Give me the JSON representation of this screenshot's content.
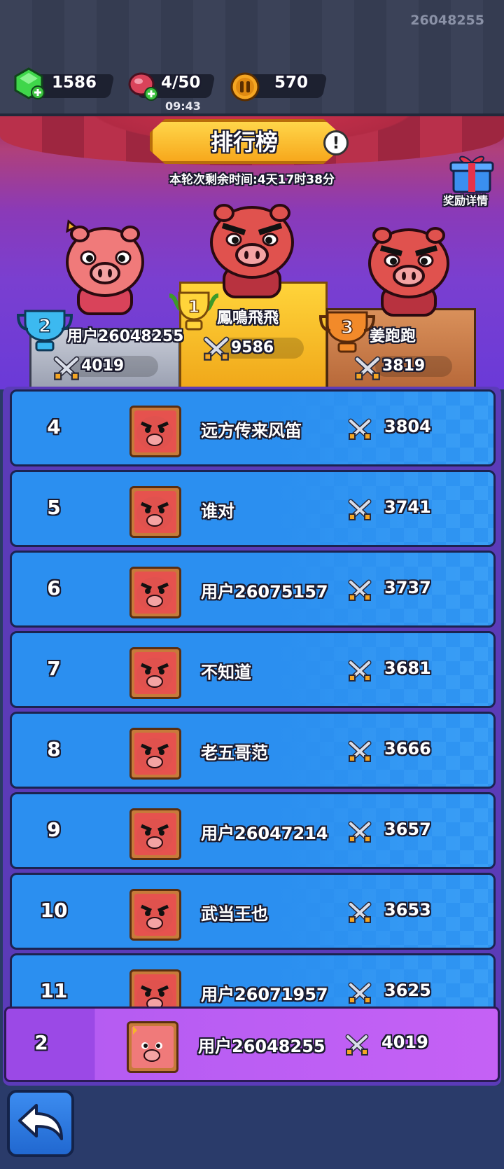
{
  "header": {
    "user_id": "26048255",
    "gems": "1586",
    "energy": "4/50",
    "energy_timer": "09:43",
    "coins": "570"
  },
  "leaderboard": {
    "title": "排行榜",
    "info_icon": "!",
    "remaining_time": "本轮次剩余时间:4天17时38分",
    "reward_label": "奖励详情"
  },
  "podium": [
    {
      "rank": "1",
      "name": "鳳鳴飛飛",
      "score": "9586"
    },
    {
      "rank": "2",
      "name": "用户26048255",
      "score": "4019"
    },
    {
      "rank": "3",
      "name": "姜跑跑",
      "score": "3819"
    }
  ],
  "rows": [
    {
      "rank": "4",
      "name": "远方传来风笛",
      "score": "3804"
    },
    {
      "rank": "5",
      "name": "谁对",
      "score": "3741"
    },
    {
      "rank": "6",
      "name": "用户26075157",
      "score": "3737"
    },
    {
      "rank": "7",
      "name": "不知道",
      "score": "3681"
    },
    {
      "rank": "8",
      "name": "老五哥范",
      "score": "3666"
    },
    {
      "rank": "9",
      "name": "用户26047214",
      "score": "3657"
    },
    {
      "rank": "10",
      "name": "武当王也",
      "score": "3653"
    },
    {
      "rank": "11",
      "name": "用户26071957",
      "score": "3625"
    }
  ],
  "my_rank": {
    "rank": "2",
    "name": "用户26048255",
    "score": "4019"
  },
  "icons": {
    "gem": "gem-icon",
    "meat": "meat-icon",
    "coin": "coin-icon",
    "gift": "gift-icon",
    "sword": "crossed-swords-icon",
    "trophy": "trophy-icon",
    "back": "back-arrow-icon"
  }
}
